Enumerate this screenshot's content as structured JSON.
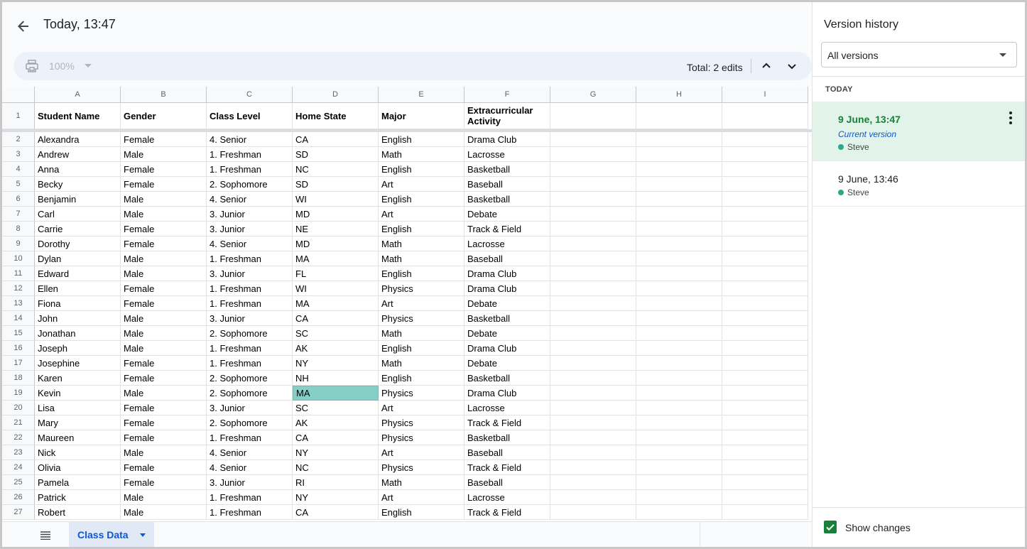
{
  "header": {
    "title": "Today, 13:47"
  },
  "toolbar": {
    "zoom": "100%",
    "total_edits": "Total: 2 edits"
  },
  "grid": {
    "columns": [
      "A",
      "B",
      "C",
      "D",
      "E",
      "F",
      "G",
      "H",
      "I"
    ],
    "header_row": {
      "num": "1",
      "cells": [
        "Student Name",
        "Gender",
        "Class Level",
        "Home State",
        "Major",
        "Extracurricular Activity",
        "",
        "",
        ""
      ]
    },
    "rows": [
      {
        "num": "2",
        "cells": [
          "Alexandra",
          "Female",
          "4. Senior",
          "CA",
          "English",
          "Drama Club"
        ]
      },
      {
        "num": "3",
        "cells": [
          "Andrew",
          "Male",
          "1. Freshman",
          "SD",
          "Math",
          "Lacrosse"
        ]
      },
      {
        "num": "4",
        "cells": [
          "Anna",
          "Female",
          "1. Freshman",
          "NC",
          "English",
          "Basketball"
        ]
      },
      {
        "num": "5",
        "cells": [
          "Becky",
          "Female",
          "2. Sophomore",
          "SD",
          "Art",
          "Baseball"
        ]
      },
      {
        "num": "6",
        "cells": [
          "Benjamin",
          "Male",
          "4. Senior",
          "WI",
          "English",
          "Basketball"
        ]
      },
      {
        "num": "7",
        "cells": [
          "Carl",
          "Male",
          "3. Junior",
          "MD",
          "Art",
          "Debate"
        ]
      },
      {
        "num": "8",
        "cells": [
          "Carrie",
          "Female",
          "3. Junior",
          "NE",
          "English",
          "Track & Field"
        ]
      },
      {
        "num": "9",
        "cells": [
          "Dorothy",
          "Female",
          "4. Senior",
          "MD",
          "Math",
          "Lacrosse"
        ]
      },
      {
        "num": "10",
        "cells": [
          "Dylan",
          "Male",
          "1. Freshman",
          "MA",
          "Math",
          "Baseball"
        ]
      },
      {
        "num": "11",
        "cells": [
          "Edward",
          "Male",
          "3. Junior",
          "FL",
          "English",
          "Drama Club"
        ]
      },
      {
        "num": "12",
        "cells": [
          "Ellen",
          "Female",
          "1. Freshman",
          "WI",
          "Physics",
          "Drama Club"
        ]
      },
      {
        "num": "13",
        "cells": [
          "Fiona",
          "Female",
          "1. Freshman",
          "MA",
          "Art",
          "Debate"
        ]
      },
      {
        "num": "14",
        "cells": [
          "John",
          "Male",
          "3. Junior",
          "CA",
          "Physics",
          "Basketball"
        ]
      },
      {
        "num": "15",
        "cells": [
          "Jonathan",
          "Male",
          "2. Sophomore",
          "SC",
          "Math",
          "Debate"
        ]
      },
      {
        "num": "16",
        "cells": [
          "Joseph",
          "Male",
          "1. Freshman",
          "AK",
          "English",
          "Drama Club"
        ]
      },
      {
        "num": "17",
        "cells": [
          "Josephine",
          "Female",
          "1. Freshman",
          "NY",
          "Math",
          "Debate"
        ]
      },
      {
        "num": "18",
        "cells": [
          "Karen",
          "Female",
          "2. Sophomore",
          "NH",
          "English",
          "Basketball"
        ]
      },
      {
        "num": "19",
        "cells": [
          "Kevin",
          "Male",
          "2. Sophomore",
          "MA",
          "Physics",
          "Drama Club"
        ]
      },
      {
        "num": "20",
        "cells": [
          "Lisa",
          "Female",
          "3. Junior",
          "SC",
          "Art",
          "Lacrosse"
        ]
      },
      {
        "num": "21",
        "cells": [
          "Mary",
          "Female",
          "2. Sophomore",
          "AK",
          "Physics",
          "Track & Field"
        ]
      },
      {
        "num": "22",
        "cells": [
          "Maureen",
          "Female",
          "1. Freshman",
          "CA",
          "Physics",
          "Basketball"
        ]
      },
      {
        "num": "23",
        "cells": [
          "Nick",
          "Male",
          "4. Senior",
          "NY",
          "Art",
          "Baseball"
        ]
      },
      {
        "num": "24",
        "cells": [
          "Olivia",
          "Female",
          "4. Senior",
          "NC",
          "Physics",
          "Track & Field"
        ]
      },
      {
        "num": "25",
        "cells": [
          "Pamela",
          "Female",
          "3. Junior",
          "RI",
          "Math",
          "Baseball"
        ]
      },
      {
        "num": "26",
        "cells": [
          "Patrick",
          "Male",
          "1. Freshman",
          "NY",
          "Art",
          "Lacrosse"
        ]
      },
      {
        "num": "27",
        "cells": [
          "Robert",
          "Male",
          "1. Freshman",
          "CA",
          "English",
          "Track & Field"
        ]
      }
    ],
    "highlight_color": "#87cec6"
  },
  "sheets": {
    "active_tab": "Class Data"
  },
  "version_panel": {
    "title": "Version history",
    "filter": "All versions",
    "group_label": "TODAY",
    "versions": [
      {
        "date": "9 June, 13:47",
        "current_label": "Current version",
        "user": "Steve"
      },
      {
        "date": "9 June, 13:46",
        "user": "Steve"
      }
    ],
    "show_changes_label": "Show changes",
    "show_changes_checked": true
  },
  "colors": {
    "accent_green": "#188038",
    "active_bg": "#e2f3ea",
    "link_blue": "#0b57d0",
    "user_dot": "#2aa88a"
  }
}
